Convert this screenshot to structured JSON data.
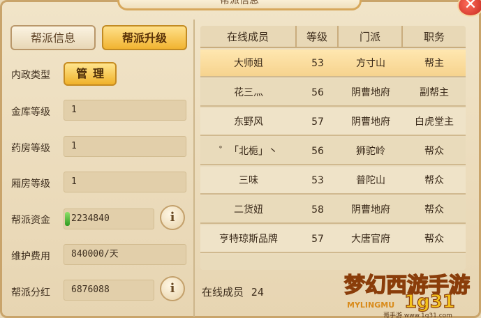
{
  "title": "帮派信息",
  "close_icon": "close-icon",
  "tabs": {
    "info": "帮派信息",
    "upgrade": "帮派升级"
  },
  "fields": {
    "domestic_type": {
      "label": "内政类型",
      "button": "管理"
    },
    "treasury_level": {
      "label": "金库等级",
      "value": "1"
    },
    "pharmacy_level": {
      "label": "药房等级",
      "value": "1"
    },
    "wing_level": {
      "label": "厢房等级",
      "value": "1"
    },
    "funds": {
      "label": "帮派资金",
      "value": "2234840"
    },
    "maintenance": {
      "label": "维护费用",
      "value": "840000/天"
    },
    "dividend": {
      "label": "帮派分红",
      "value": "6876088"
    }
  },
  "table": {
    "headers": [
      "在线成员",
      "等级",
      "门派",
      "职务"
    ],
    "rows": [
      {
        "name": "大师姐",
        "level": "53",
        "school": "方寸山",
        "role": "帮主"
      },
      {
        "name": "花三灬",
        "level": "56",
        "school": "阴曹地府",
        "role": "副帮主"
      },
      {
        "name": "东野风",
        "level": "57",
        "school": "阴曹地府",
        "role": "白虎堂主"
      },
      {
        "name": "゜「北栀」丶",
        "level": "56",
        "school": "狮驼岭",
        "role": "帮众"
      },
      {
        "name": "三味",
        "level": "53",
        "school": "普陀山",
        "role": "帮众"
      },
      {
        "name": "二货妞",
        "level": "58",
        "school": "阴曹地府",
        "role": "帮众"
      },
      {
        "name": "亨特琼斯品牌",
        "level": "57",
        "school": "大唐官府",
        "role": "帮众"
      }
    ]
  },
  "online_label": "在线成员",
  "online_count": "24",
  "logo": {
    "text": "梦幻西游手游",
    "sub": "MYLINGMU",
    "site": "1g31",
    "footer": "哥手游 www.1g31.com"
  },
  "colors": {
    "accent": "#f1b431",
    "selected_row": "#f6d38e",
    "close": "#c3281c"
  }
}
